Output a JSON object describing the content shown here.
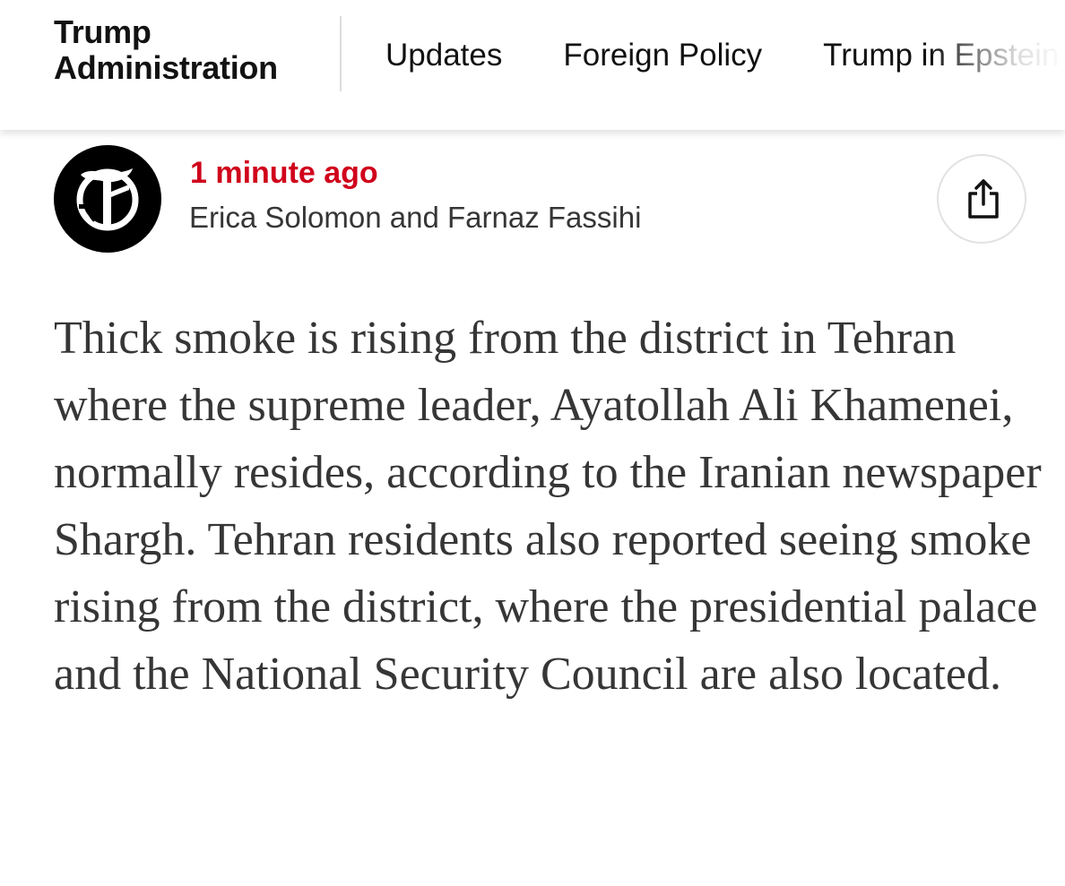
{
  "header": {
    "section_title_line1": "Trump",
    "section_title_line2": "Administration",
    "nav_links": [
      "Updates",
      "Foreign Policy",
      "Trump in Epstein"
    ]
  },
  "byline": {
    "timestamp": "1 minute ago",
    "authors": "Erica Solomon and Farnaz Fassihi",
    "logo_icon": "nyt-t-logo-icon",
    "share_icon": "share-icon"
  },
  "article": {
    "body": "Thick smoke is rising from the district in Tehran where the supreme leader, Ayatollah Ali Khamenei, normally resides, according to the Iranian newspaper Shargh. Tehran residents also reported seeing smoke rising from the district, where the presidential palace and the National Security Council are also located."
  },
  "colors": {
    "accent_red": "#d0021b",
    "text_dark": "#121212",
    "text_body": "#363636",
    "divider": "#dcdcdc"
  }
}
